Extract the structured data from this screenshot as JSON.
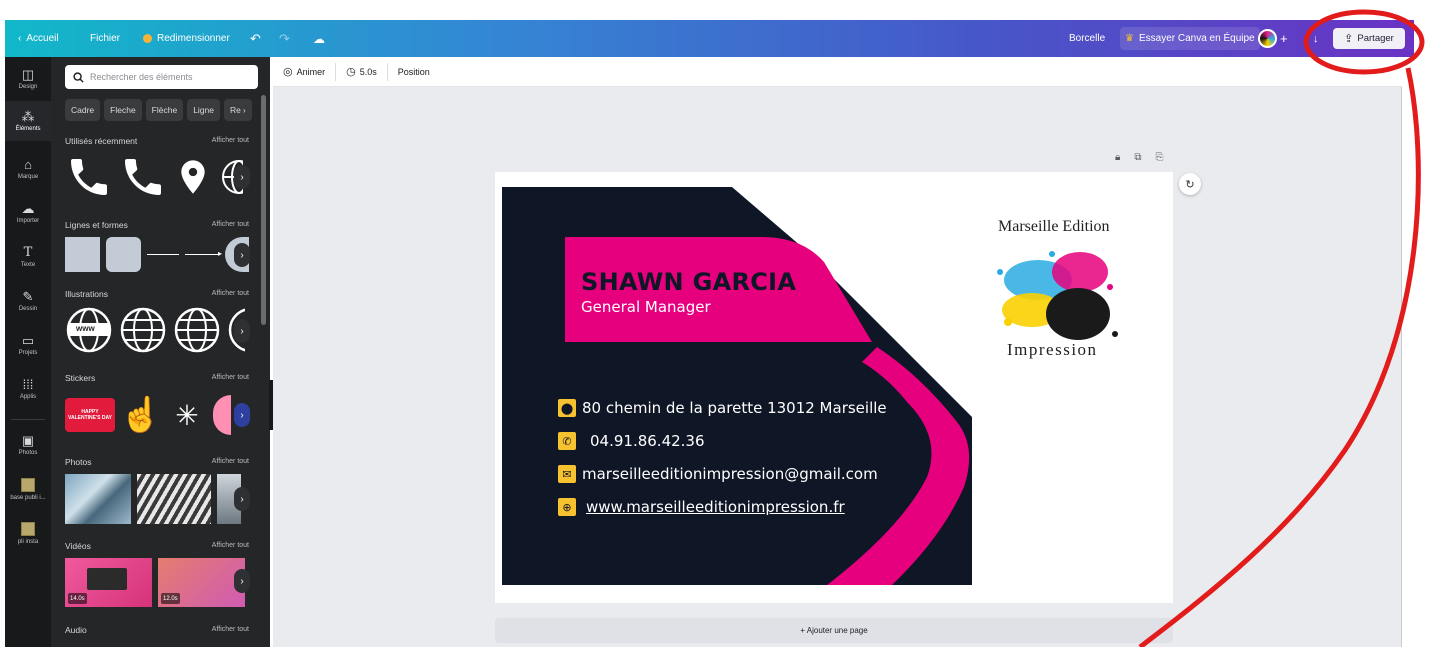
{
  "topbar": {
    "back_label": "Accueil",
    "file_label": "Fichier",
    "resize_label": "Redimensionner",
    "team_name": "Borcelle",
    "try_team_label": "Essayer Canva en Équipe",
    "plus_label": "+",
    "share_label": "Partager"
  },
  "rail": {
    "items": [
      {
        "label": "Design",
        "icon": "layout-icon"
      },
      {
        "label": "Éléments",
        "icon": "elements-icon"
      },
      {
        "label": "Marque",
        "icon": "brand-icon"
      },
      {
        "label": "Importer",
        "icon": "upload-icon"
      },
      {
        "label": "Texte",
        "icon": "text-icon"
      },
      {
        "label": "Dessin",
        "icon": "draw-icon"
      },
      {
        "label": "Projets",
        "icon": "folder-icon"
      },
      {
        "label": "Applis",
        "icon": "apps-icon"
      },
      {
        "label": "Photos",
        "icon": "photo-icon"
      },
      {
        "label": "base publi i...",
        "icon": "thumbnail"
      },
      {
        "label": "pli insta",
        "icon": "thumbnail"
      }
    ]
  },
  "panel": {
    "search_placeholder": "Rechercher des éléments",
    "chips": [
      "Cadre",
      "Fleche",
      "Flèche",
      "Ligne",
      "Re"
    ],
    "see_all": "Afficher tout",
    "sections": {
      "recent": "Utilisés récemment",
      "shapes": "Lignes et formes",
      "illustrations": "Illustrations",
      "stickers": "Stickers",
      "photos": "Photos",
      "videos": "Vidéos",
      "audio": "Audio"
    },
    "video_durations": [
      "14.0s",
      "12.0s"
    ],
    "www_label": "www",
    "sticker_text": "HAPPY VALENTINE'S DAY"
  },
  "toolbar": {
    "animate_label": "Animer",
    "duration_label": "5.0s",
    "position_label": "Position"
  },
  "card": {
    "name": "SHAWN GARCIA",
    "job_title": "General Manager",
    "address": "80 chemin de la parette 13012 Marseille",
    "phone": "04.91.86.42.36",
    "email": "marseilleeditionimpression@gmail.com",
    "website": "www.marseilleeditionimpression.fr",
    "logo_top": "Marseille Edition",
    "logo_bottom": "Impression"
  },
  "add_page_label": "+ Ajouter une page",
  "colors": {
    "card_navy": "#0f1626",
    "card_pink": "#e6007e",
    "accent_yellow": "#f7c22f",
    "annotation_red": "#e21b1b"
  }
}
